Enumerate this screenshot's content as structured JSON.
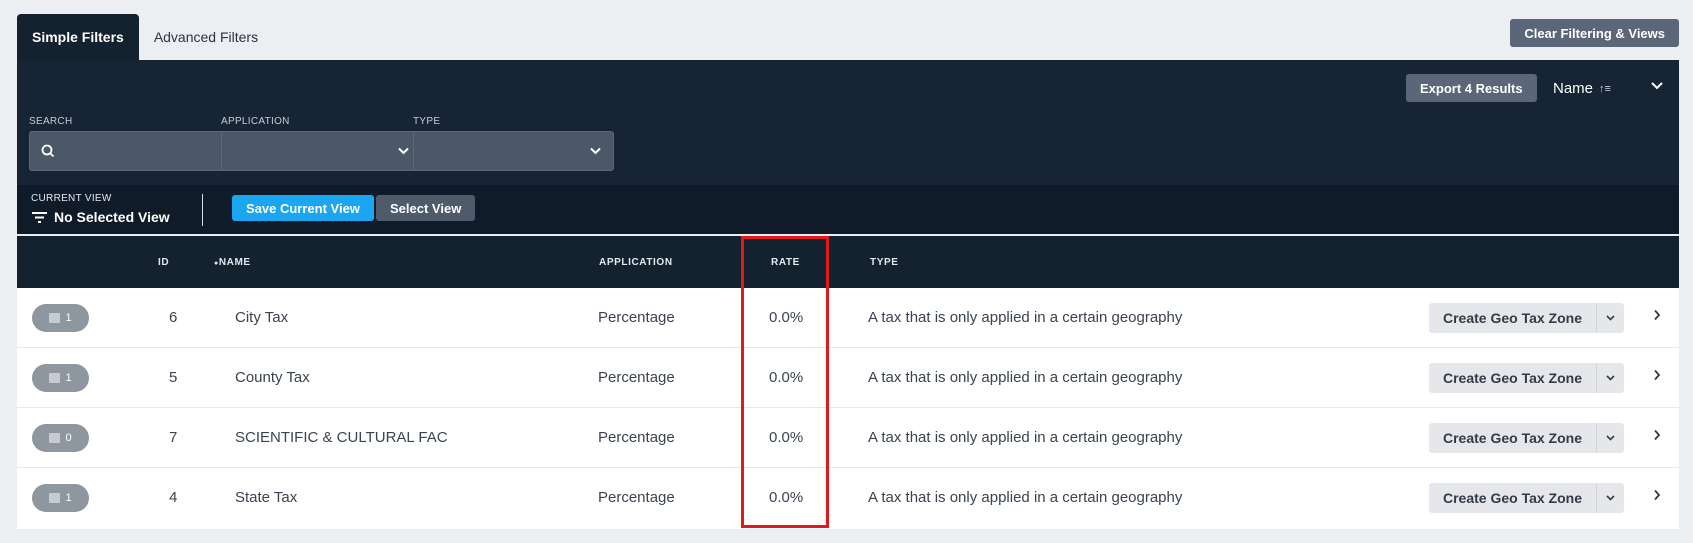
{
  "tabs": [
    {
      "label": "Simple Filters",
      "active": true
    },
    {
      "label": "Advanced Filters",
      "active": false
    }
  ],
  "clear_button": "Clear Filtering & Views",
  "toolbar": {
    "export_label": "Export 4 Results",
    "sort_label": "Name",
    "sort_icon": "↑≡"
  },
  "filters": {
    "search": {
      "label": "SEARCH",
      "value": ""
    },
    "application": {
      "label": "APPLICATION",
      "value": ""
    },
    "type": {
      "label": "TYPE",
      "value": ""
    }
  },
  "view": {
    "label": "CURRENT VIEW",
    "value": "No Selected View",
    "save_label": "Save Current View",
    "select_label": "Select View"
  },
  "columns": {
    "id": "ID",
    "name": "NAME",
    "application": "APPLICATION",
    "rate": "RATE",
    "type": "TYPE"
  },
  "rows": [
    {
      "count": "1",
      "id": "6",
      "name": "City Tax",
      "application": "Percentage",
      "rate": "0.0%",
      "type": "A tax that is only applied in a certain geography",
      "action": "Create Geo Tax Zone"
    },
    {
      "count": "1",
      "id": "5",
      "name": "County Tax",
      "application": "Percentage",
      "rate": "0.0%",
      "type": "A tax that is only applied in a certain geography",
      "action": "Create Geo Tax Zone"
    },
    {
      "count": "0",
      "id": "7",
      "name": "SCIENTIFIC & CULTURAL FAC",
      "application": "Percentage",
      "rate": "0.0%",
      "type": "A tax that is only applied in a certain geography",
      "action": "Create Geo Tax Zone"
    },
    {
      "count": "1",
      "id": "4",
      "name": "State Tax",
      "application": "Percentage",
      "rate": "0.0%",
      "type": "A tax that is only applied in a certain geography",
      "action": "Create Geo Tax Zone"
    }
  ],
  "colors": {
    "panel": "#162434",
    "accent": "#1aa6f0",
    "highlight": "#e01a1a"
  }
}
